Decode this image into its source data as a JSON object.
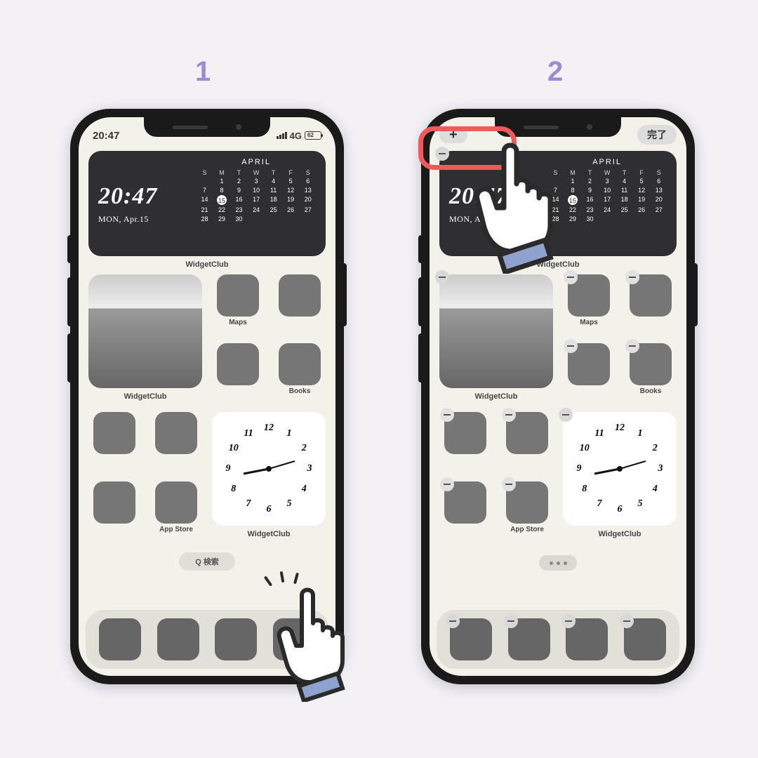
{
  "steps": {
    "one": "1",
    "two": "2"
  },
  "status": {
    "time": "20:47",
    "net": "4G"
  },
  "editbar": {
    "plus": "+",
    "done": "完了"
  },
  "calendar": {
    "time": "20:47",
    "date": "MON, Apr.15",
    "month": "APRIL",
    "dow": [
      "S",
      "M",
      "T",
      "W",
      "T",
      "F",
      "S"
    ],
    "weeks": [
      [
        "",
        "1",
        "2",
        "3",
        "4",
        "5",
        "6"
      ],
      [
        "7",
        "8",
        "9",
        "10",
        "11",
        "12",
        "13"
      ],
      [
        "14",
        "15",
        "16",
        "17",
        "18",
        "19",
        "20"
      ],
      [
        "21",
        "22",
        "23",
        "24",
        "25",
        "26",
        "27"
      ],
      [
        "28",
        "29",
        "30",
        "",
        "",
        "",
        ""
      ]
    ],
    "today": "15",
    "label": "WidgetClub"
  },
  "apps": {
    "maps": "Maps",
    "books": "Books",
    "widgetclub": "WidgetClub",
    "appstore": "App Store"
  },
  "clock": {
    "numbers": [
      "12",
      "1",
      "2",
      "3",
      "4",
      "5",
      "6",
      "7",
      "8",
      "9",
      "10",
      "11"
    ],
    "label": "WidgetClub"
  },
  "search": {
    "label": "検索",
    "icon": "Q"
  },
  "bigphoto_label": "WidgetClub"
}
